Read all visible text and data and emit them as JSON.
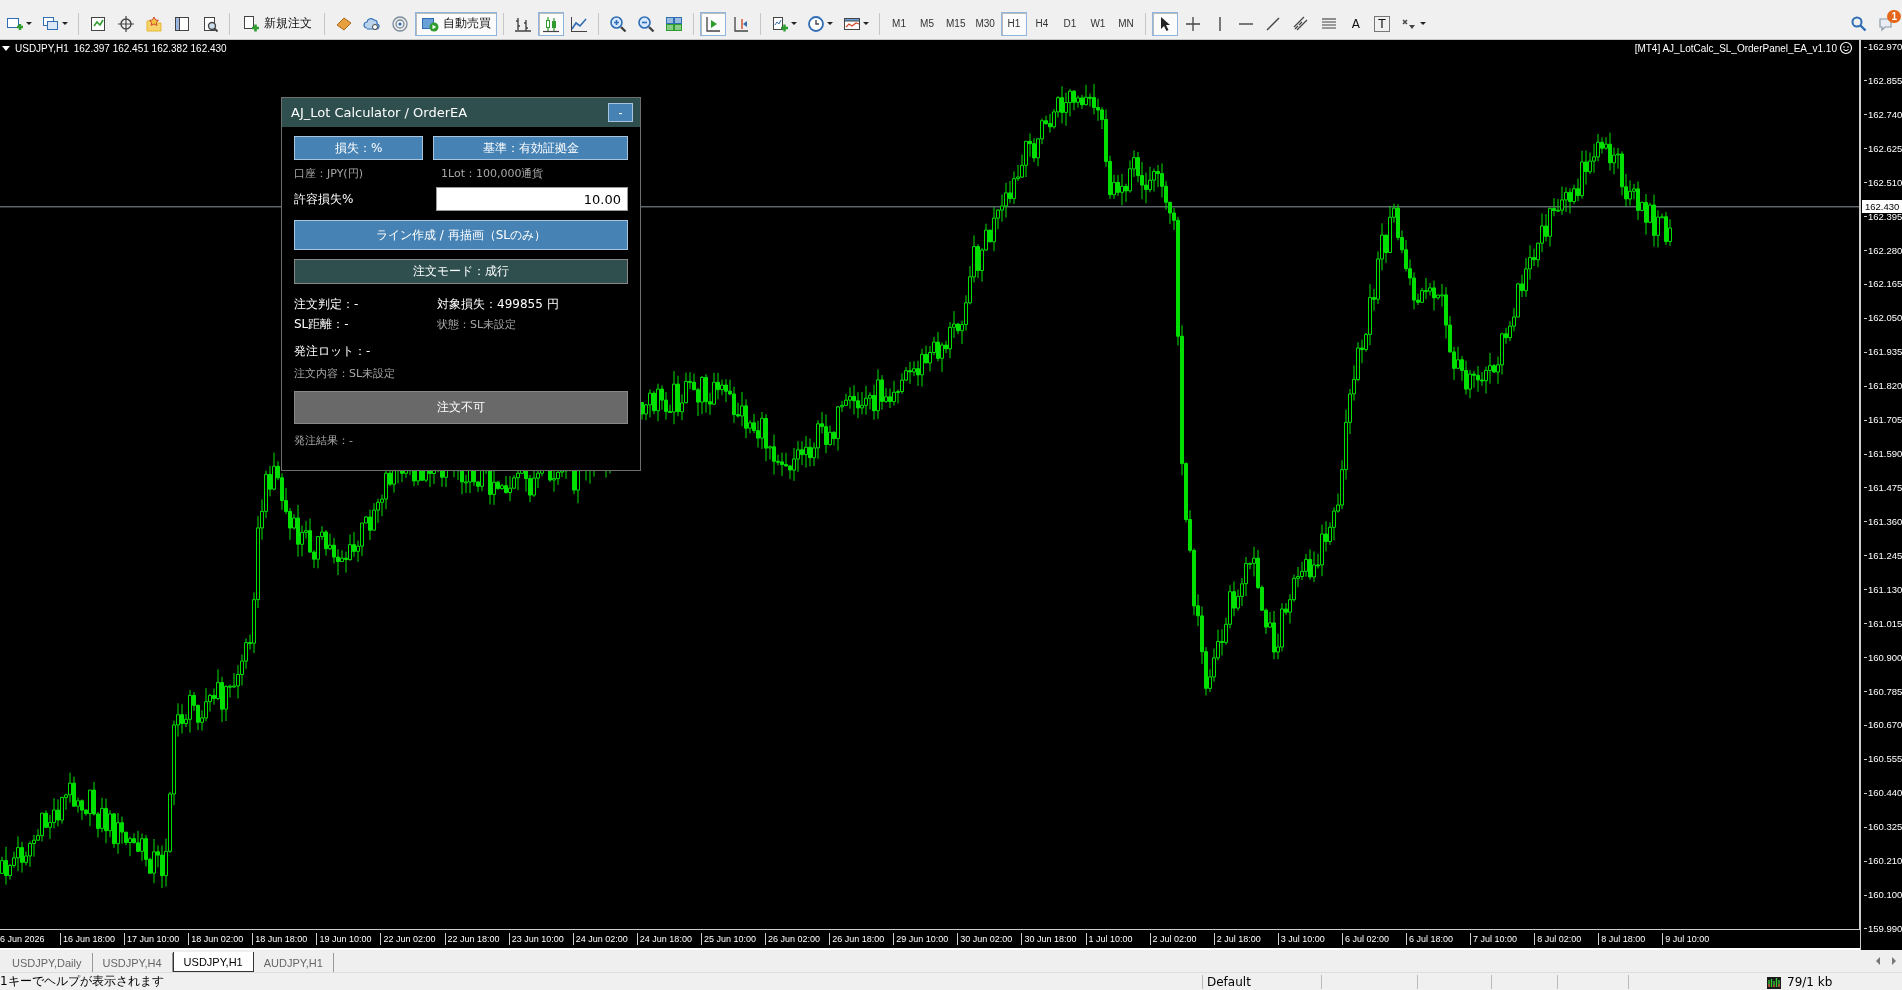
{
  "toolbar": {
    "new_order": {
      "label": "新規注文"
    },
    "auto_trading": {
      "label": "自動売買",
      "on": true
    },
    "chart_types": [
      {
        "kind": "bar",
        "selected": false
      },
      {
        "kind": "candle",
        "selected": true
      },
      {
        "kind": "line",
        "selected": false
      }
    ],
    "chart_shift": [
      {
        "kind": "autoscroll",
        "selected": true
      },
      {
        "kind": "shift",
        "selected": false
      }
    ],
    "timeframes": [
      {
        "label": "M1",
        "selected": false
      },
      {
        "label": "M5",
        "selected": false
      },
      {
        "label": "M15",
        "selected": false
      },
      {
        "label": "M30",
        "selected": false
      },
      {
        "label": "H1",
        "selected": true
      },
      {
        "label": "H4",
        "selected": false
      },
      {
        "label": "D1",
        "selected": false
      },
      {
        "label": "W1",
        "selected": false
      },
      {
        "label": "MN",
        "selected": false
      }
    ],
    "tools": [
      {
        "kind": "cursor",
        "selected": true
      },
      {
        "kind": "crosshair",
        "selected": false
      },
      {
        "kind": "vline",
        "selected": false
      },
      {
        "kind": "hline",
        "selected": false
      },
      {
        "kind": "trendline",
        "selected": false
      },
      {
        "kind": "channel",
        "selected": false
      },
      {
        "kind": "fibo",
        "selected": false
      },
      {
        "kind": "text",
        "label": "A",
        "selected": false
      },
      {
        "kind": "label",
        "label": "T",
        "selected": false
      },
      {
        "kind": "arrows",
        "selected": false
      }
    ],
    "notification_count": "1"
  },
  "chart": {
    "symbol": "USDJPY,H1",
    "ohlc": "162.397 162.451 162.382 162.430",
    "ea_label": "[MT4] AJ_LotCalc_SL_OrderPanel_EA_v1.10",
    "current_price": "162.430",
    "price_ticks": [
      "162.970",
      "162.855",
      "162.740",
      "162.625",
      "162.510",
      "162.395",
      "162.280",
      "162.165",
      "162.050",
      "161.935",
      "161.820",
      "161.705",
      "161.590",
      "161.475",
      "161.360",
      "161.245",
      "161.130",
      "161.015",
      "160.900",
      "160.785",
      "160.670",
      "160.555",
      "160.440",
      "160.325",
      "160.210",
      "160.100",
      "159.990"
    ],
    "time_labels": [
      "6 Jun 2026",
      "16 Jun 18:00",
      "17 Jun 10:00",
      "18 Jun 02:00",
      "18 Jun 18:00",
      "19 Jun 10:00",
      "22 Jun 02:00",
      "22 Jun 18:00",
      "23 Jun 10:00",
      "24 Jun 02:00",
      "24 Jun 18:00",
      "25 Jun 10:00",
      "26 Jun 02:00",
      "26 Jun 18:00",
      "29 Jun 10:00",
      "30 Jun 02:00",
      "30 Jun 18:00",
      "1 Jul 10:00",
      "2 Jul 02:00",
      "2 Jul 18:00",
      "3 Jul 10:00",
      "6 Jul 02:00",
      "6 Jul 18:00",
      "7 Jul 10:00",
      "8 Jul 02:00",
      "8 Jul 18:00",
      "9 Jul 10:00"
    ]
  },
  "panel": {
    "title": "AJ_Lot Calculator / OrderEA",
    "minimize": "-",
    "loss_mode_button": "損失：%",
    "basis_button": "基準：有効証拠金",
    "account": "口座：JPY(円)",
    "lot_size": "1Lot：100,000通貨",
    "risk_label": "許容損失%",
    "risk_value": "10.00",
    "draw_line_button": "ライン作成 / 再描画（SLのみ）",
    "order_mode_button": "注文モード：成行",
    "order_judgement": "注文判定：-",
    "target_loss": "対象損失：499855 円",
    "sl_distance": "SL距離：-",
    "status": "状態：SL未設定",
    "order_lot": "発注ロット：-",
    "order_detail": "注文内容：SL未設定",
    "order_button": {
      "label": "注文不可",
      "disabled": true
    },
    "order_result": "発注結果：-"
  },
  "tabs": [
    {
      "label": "USDJPY,Daily",
      "selected": false
    },
    {
      "label": "USDJPY,H4",
      "selected": false
    },
    {
      "label": "USDJPY,H1",
      "selected": true
    },
    {
      "label": "AUDJPY,H1",
      "selected": false
    }
  ],
  "status_bar": {
    "help": "1キーでヘルプが表示されます",
    "profile": "Default",
    "traffic": "79/1 kb"
  }
}
